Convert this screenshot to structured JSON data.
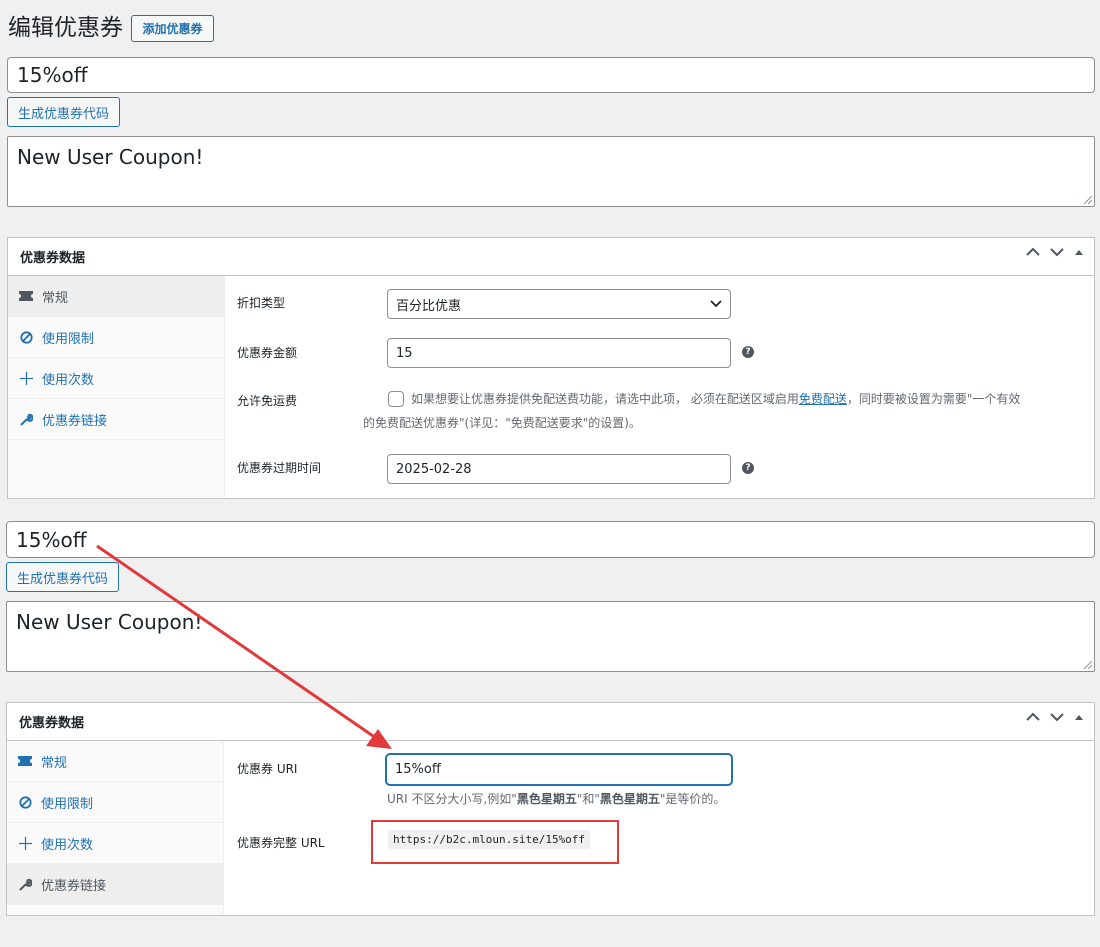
{
  "page": {
    "title": "编辑优惠券",
    "add_button": "添加优惠券"
  },
  "top": {
    "coupon_code": "15%off",
    "generate_button": "生成优惠券代码",
    "description": "New User Coupon!",
    "panel": {
      "title": "优惠券数据",
      "tabs": [
        {
          "label": "常规",
          "icon": "ticket-icon"
        },
        {
          "label": "使用限制",
          "icon": "prohibited-icon"
        },
        {
          "label": "使用次数",
          "icon": "plus-cross-icon"
        },
        {
          "label": "优惠券链接",
          "icon": "wrench-icon"
        }
      ],
      "active_tab": "常规",
      "discount_type_label": "折扣类型",
      "discount_type_value": "百分比优惠",
      "amount_label": "优惠券金额",
      "amount_value": "15",
      "free_shipping_label": "允许免运费",
      "free_shipping_note_a": "如果想要让优惠券提供免配送费功能，请选中此项， 必须在配送区域启用",
      "free_shipping_link": "免费配送",
      "free_shipping_note_b": "，同时要被设置为需要\"一个有效",
      "free_shipping_note_c": "的免费配送优惠券\"(详见：\"免费配送要求\"的设置)。",
      "expiry_label": "优惠券过期时间",
      "expiry_value": "2025-02-28"
    }
  },
  "bottom": {
    "coupon_code": "15%off",
    "generate_button": "生成优惠券代码",
    "description": "New User Coupon!",
    "panel": {
      "title": "优惠券数据",
      "tabs": [
        {
          "label": "常规",
          "icon": "ticket-icon"
        },
        {
          "label": "使用限制",
          "icon": "prohibited-icon"
        },
        {
          "label": "使用次数",
          "icon": "plus-cross-icon"
        },
        {
          "label": "优惠券链接",
          "icon": "wrench-icon"
        }
      ],
      "active_tab": "优惠券链接",
      "uri_label": "优惠券 URI",
      "uri_value": "15%off",
      "uri_note_a": "URI 不区分大小写,例如\"",
      "uri_note_b": "黑色星期五",
      "uri_note_c": "\"和\"",
      "uri_note_d": "黑色星期五",
      "uri_note_e": "\"是等价的。",
      "full_url_label": "优惠券完整 URL",
      "full_url_value": "https://b2c.mloun.site/15%off"
    }
  },
  "colors": {
    "accent": "#2271b1",
    "annotation": "#e03a3a",
    "background": "#f0f0f1"
  }
}
